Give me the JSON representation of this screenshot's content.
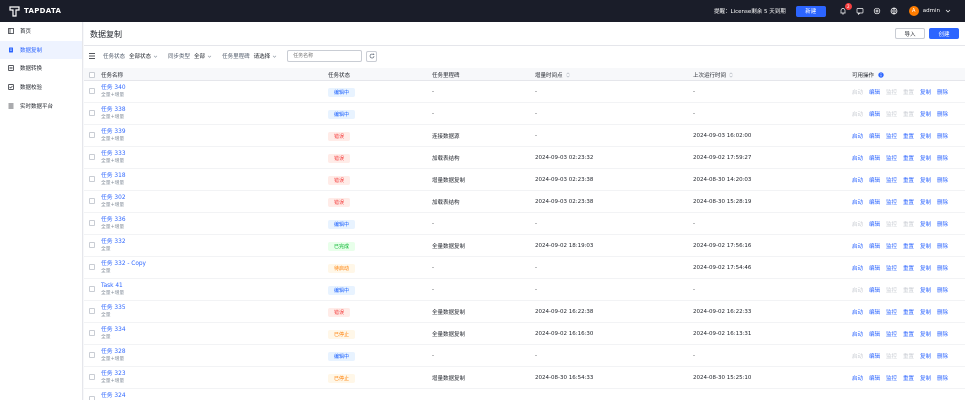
{
  "app": {
    "logo_text": "TAPDATA"
  },
  "header": {
    "license_text": "提醒：License剩余 5 天到期",
    "new_button": "新建",
    "notification_count": "2",
    "user_initial": "A",
    "username": "admin"
  },
  "sidebar": {
    "items": [
      {
        "label": "首页",
        "icon": "home-icon"
      },
      {
        "label": "数据复制",
        "icon": "copy-icon",
        "active": true
      },
      {
        "label": "数据转换",
        "icon": "transform-icon"
      },
      {
        "label": "数据校验",
        "icon": "verify-icon"
      },
      {
        "label": "实时数据平台",
        "icon": "platform-icon"
      }
    ]
  },
  "page": {
    "title": "数据复制",
    "import_label": "导入",
    "create_label": "创建"
  },
  "filters": {
    "status_label": "任务状态",
    "status_value": "全部状态",
    "sync_label": "同步类型",
    "sync_value": "全部",
    "milestone_label": "任务里程碑",
    "milestone_value": "请选择",
    "search_placeholder": "任务名称"
  },
  "table": {
    "columns": [
      "任务名称",
      "任务状态",
      "任务里程碑",
      "增量时间点",
      "上次运行时间",
      "可用操作"
    ],
    "ops": [
      "启动",
      "编辑",
      "监控",
      "重置",
      "复制",
      "删除"
    ],
    "rows": [
      {
        "name": "任务 340",
        "type": "全量+增量",
        "status": "编辑中",
        "status_kind": "editing",
        "milestone": "-",
        "inc_time": "-",
        "last_run": "-",
        "ops_enabled": [
          false,
          true,
          false,
          false,
          true,
          true
        ]
      },
      {
        "name": "任务 338",
        "type": "全量+增量",
        "status": "编辑中",
        "status_kind": "editing",
        "milestone": "-",
        "inc_time": "-",
        "last_run": "-",
        "ops_enabled": [
          false,
          true,
          false,
          false,
          true,
          true
        ]
      },
      {
        "name": "任务 339",
        "type": "全量+增量",
        "status": "错误",
        "status_kind": "error",
        "milestone": "连接数据源",
        "inc_time": "-",
        "last_run": "2024-09-03 16:02:00",
        "ops_enabled": [
          true,
          true,
          true,
          true,
          true,
          true
        ]
      },
      {
        "name": "任务 333",
        "type": "全量+增量",
        "status": "错误",
        "status_kind": "error",
        "milestone": "加载表结构",
        "inc_time": "2024-09-03 02:23:32",
        "last_run": "2024-09-02 17:59:27",
        "ops_enabled": [
          true,
          true,
          true,
          true,
          true,
          true
        ]
      },
      {
        "name": "任务 318",
        "type": "全量+增量",
        "status": "错误",
        "status_kind": "error",
        "milestone": "增量数据复制",
        "inc_time": "2024-09-03 02:23:38",
        "last_run": "2024-08-30 14:20:03",
        "ops_enabled": [
          true,
          true,
          true,
          true,
          true,
          true
        ]
      },
      {
        "name": "任务 302",
        "type": "全量+增量",
        "status": "错误",
        "status_kind": "error",
        "milestone": "加载表结构",
        "inc_time": "2024-09-03 02:23:38",
        "last_run": "2024-08-30 15:28:19",
        "ops_enabled": [
          true,
          true,
          true,
          true,
          true,
          true
        ]
      },
      {
        "name": "任务 336",
        "type": "全量+增量",
        "status": "编辑中",
        "status_kind": "editing",
        "milestone": "-",
        "inc_time": "-",
        "last_run": "-",
        "ops_enabled": [
          false,
          true,
          false,
          false,
          true,
          true
        ]
      },
      {
        "name": "任务 332",
        "type": "全量",
        "status": "已完成",
        "status_kind": "done",
        "milestone": "全量数据复制",
        "inc_time": "2024-09-02 18:19:03",
        "last_run": "2024-09-02 17:56:16",
        "ops_enabled": [
          true,
          true,
          true,
          true,
          true,
          true
        ]
      },
      {
        "name": "任务 332 - Copy",
        "type": "全量",
        "status": "待启动",
        "status_kind": "pending",
        "milestone": "-",
        "inc_time": "-",
        "last_run": "2024-09-02 17:54:46",
        "ops_enabled": [
          true,
          true,
          true,
          true,
          true,
          true
        ]
      },
      {
        "name": "Task 41",
        "type": "全量+增量",
        "status": "编辑中",
        "status_kind": "editing",
        "milestone": "-",
        "inc_time": "-",
        "last_run": "-",
        "ops_enabled": [
          false,
          true,
          false,
          false,
          true,
          true
        ]
      },
      {
        "name": "任务 335",
        "type": "全量",
        "status": "错误",
        "status_kind": "error",
        "milestone": "全量数据复制",
        "inc_time": "2024-09-02 16:22:38",
        "last_run": "2024-09-02 16:22:33",
        "ops_enabled": [
          true,
          true,
          true,
          true,
          true,
          true
        ]
      },
      {
        "name": "任务 334",
        "type": "全量",
        "status": "已停止",
        "status_kind": "stopped",
        "milestone": "全量数据复制",
        "inc_time": "2024-09-02 16:16:30",
        "last_run": "2024-09-02 16:13:31",
        "ops_enabled": [
          true,
          true,
          true,
          true,
          true,
          true
        ]
      },
      {
        "name": "任务 328",
        "type": "全量+增量",
        "status": "编辑中",
        "status_kind": "editing",
        "milestone": "-",
        "inc_time": "-",
        "last_run": "-",
        "ops_enabled": [
          false,
          true,
          false,
          false,
          true,
          true
        ]
      },
      {
        "name": "任务 323",
        "type": "全量+增量",
        "status": "已停止",
        "status_kind": "stopped",
        "milestone": "增量数据复制",
        "inc_time": "2024-08-30 16:54:33",
        "last_run": "2024-08-30 15:25:10",
        "ops_enabled": [
          true,
          true,
          true,
          true,
          true,
          true
        ]
      },
      {
        "name": "任务 324",
        "type": "",
        "status": "",
        "status_kind": "",
        "milestone": "",
        "inc_time": "",
        "last_run": "",
        "ops_enabled": []
      }
    ]
  },
  "colors": {
    "accent": "#2c65ff",
    "topbar": "#1a1d29"
  }
}
